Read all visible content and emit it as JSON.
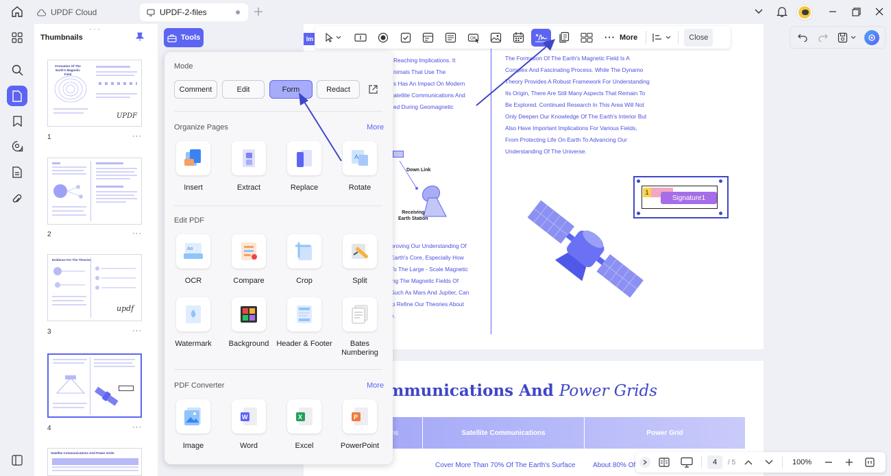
{
  "titlebar": {
    "tabs": [
      {
        "label": "UPDF Cloud"
      },
      {
        "label": "UPDF-2-files"
      }
    ]
  },
  "thumbnails": {
    "title": "Thumbnails",
    "pages": [
      "1",
      "2",
      "3",
      "4"
    ],
    "page1_title": "Formation Of The Earth's Magnetic Field",
    "page3_title": "Evidence For The Theories",
    "page5_title": "Satellite Communications And Power Grids"
  },
  "tools_button": {
    "label": "Tools"
  },
  "panel": {
    "mode_title": "Mode",
    "mode_buttons": [
      "Comment",
      "Edit",
      "Form",
      "Redact"
    ],
    "organize_title": "Organize Pages",
    "organize_more": "More",
    "organize_items": [
      "Insert",
      "Extract",
      "Replace",
      "Rotate"
    ],
    "edit_title": "Edit PDF",
    "edit_items": [
      "OCR",
      "Compare",
      "Crop",
      "Split",
      "Watermark",
      "Background",
      "Header & Footer",
      "Bates Numbering"
    ],
    "converter_title": "PDF Converter",
    "converter_more": "More",
    "converter_items": [
      "Image",
      "Word",
      "Excel",
      "PowerPoint"
    ]
  },
  "toolbar": {
    "more_label": "More",
    "close_label": "Close"
  },
  "document": {
    "left_col": [
      "Reaching Implications. It",
      "nimals That Use The",
      "s Has An Impact On Modern",
      "atellite Communications And",
      "ed During Geomagnetic"
    ],
    "right_col": [
      "The Formation Of The Earth's Magnetic Field Is A",
      "Complex And Fascinating Process. While The Dynamo",
      "Theory Provides A Robust Framework For Understanding",
      "Its Origin, There Are Still Many Aspects That Remain To",
      "Be Explored. Continued Research In This Area Will Not",
      "Only Deepen Our Knowledge Of The Earth's Interior But",
      "Also Have Important Implications For Various Fields,",
      "From Protecting Life On Earth To Advancing Our",
      "Understanding Of The Universe."
    ],
    "left_col2": [
      "proving Our Understanding Of",
      "Earth's Core, Especially How",
      "To The Large - Scale Magnetic",
      "ing The Magnetic Fields Of",
      "Such As Mars And Jupiter, Can",
      "lp Refine Our Theories About",
      "e."
    ],
    "down_link": "Down Link",
    "receiving": "Receiving",
    "earth_station": "Earth Station",
    "signature": "Signature1",
    "badge_num": "1",
    "page2_heading_a": "mmunications And ",
    "page2_heading_b": "Power Grids",
    "table_headers": [
      "ons",
      "Satellite Communications",
      "Power Grid"
    ],
    "table_row": [
      "Cover More Than 70% Of The Earth's Surface",
      "About 80% Of"
    ],
    "im_label": "Im"
  },
  "bottom": {
    "page_current": "4",
    "page_total": "/ 5",
    "zoom": "100%"
  },
  "colors": {
    "accent": "#5c64f3",
    "doc_text": "#4a4fe0"
  }
}
